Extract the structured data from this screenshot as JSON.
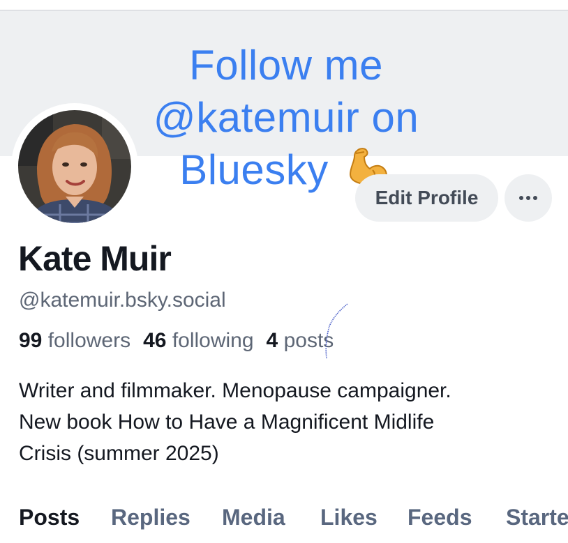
{
  "banner": {
    "line1": "Follow me",
    "line2": "@katemuir on",
    "line3": "Bluesky"
  },
  "icons": {
    "flex": "flexed-biceps-icon",
    "more": "ellipsis-icon"
  },
  "profile": {
    "display_name": "Kate Muir",
    "handle": "@katemuir.bsky.social",
    "followers_count": "99",
    "followers_label": "followers",
    "following_count": "46",
    "following_label": "following",
    "posts_count": "4",
    "posts_label": "posts",
    "bio_line1": "Writer and filmmaker. Menopause campaigner.",
    "bio_line2": "New book How to Have a Magnificent Midlife",
    "bio_line3": "Crisis (summer 2025)"
  },
  "actions": {
    "edit_profile": "Edit Profile"
  },
  "tabs": {
    "posts": "Posts",
    "replies": "Replies",
    "media": "Media",
    "likes": "Likes",
    "feeds": "Feeds",
    "starter_packs": "Starte"
  },
  "colors": {
    "accent": "#3b7ff0",
    "banner_bg": "#eef0f2",
    "text_primary": "#141820",
    "text_secondary": "#5d6675"
  }
}
